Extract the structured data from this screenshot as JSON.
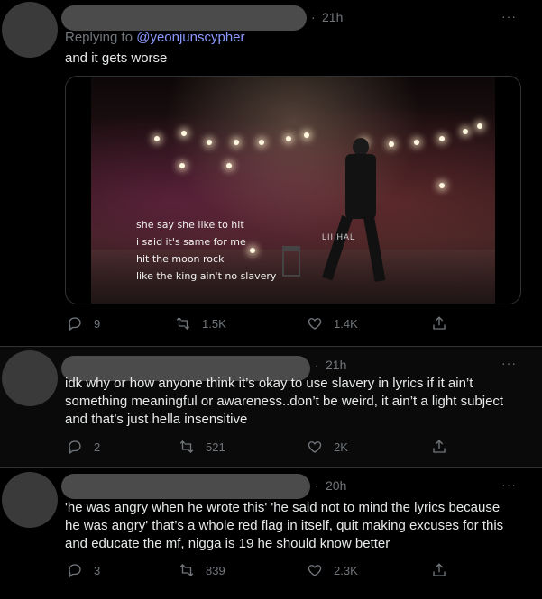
{
  "tweets": [
    {
      "dot": "·",
      "time": "21h",
      "more": "···",
      "replying_prefix": "Replying to ",
      "replying_handle": "@yeonjunscypher",
      "text": "and it gets worse",
      "media": {
        "lyrics": [
          "she say she like to hit",
          "i said it's same for me",
          "hit the moon rock",
          "like the king ain't no slavery"
        ],
        "banner": "LII   HAL"
      },
      "replies": "9",
      "retweets": "1.5K",
      "likes": "1.4K"
    },
    {
      "dot": "·",
      "time": "21h",
      "more": "···",
      "text": "idk why or how anyone think it’s okay to use slavery in lyrics if it ain’t something meaningful or awareness..don’t be weird, it ain’t a light subject and that’s just hella insensitive",
      "replies": "2",
      "retweets": "521",
      "likes": "2K"
    },
    {
      "dot": "·",
      "time": "20h",
      "more": "···",
      "text": "'he was angry when he wrote this' 'he said not to mind the lyrics because he was angry' that’s a whole red flag in itself, quit making excuses for this and educate the mf, nigga is 19 he should know better",
      "replies": "3",
      "retweets": "839",
      "likes": "2.3K"
    }
  ]
}
